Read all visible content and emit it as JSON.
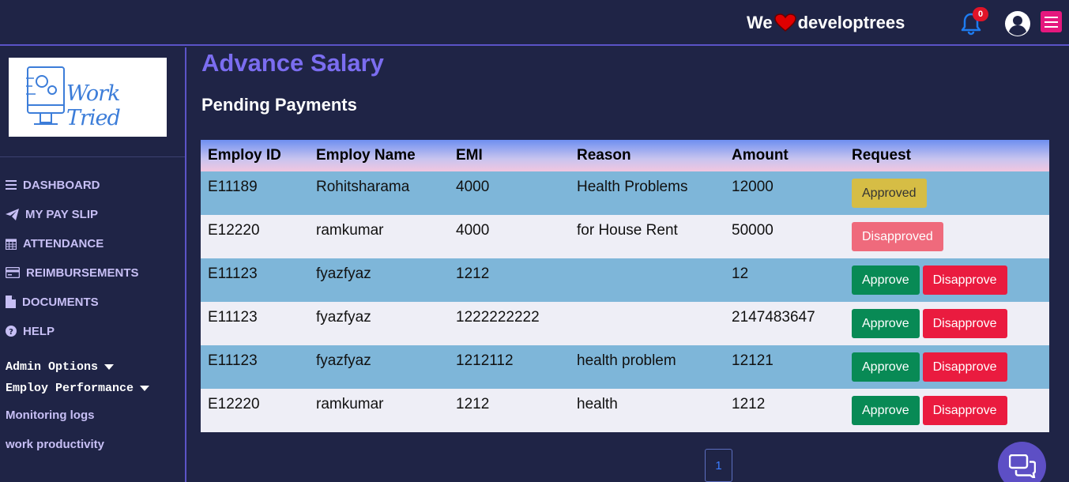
{
  "topbar": {
    "brand_before": "We",
    "brand_after": "developtrees",
    "notification_count": "0",
    "icons": [
      "heart-icon",
      "bell-icon",
      "user-circle-icon",
      "hamburger-menu-icon"
    ]
  },
  "sidebar": {
    "logo_text": "Work Tried",
    "nav": [
      {
        "label": "DASHBOARD",
        "icon": "bars-icon"
      },
      {
        "label": "MY PAY SLIP",
        "icon": "paper-plane-icon"
      },
      {
        "label": "ATTENDANCE",
        "icon": "calendar-icon"
      },
      {
        "label": "REIMBURSEMENTS",
        "icon": "credit-card-icon"
      },
      {
        "label": "DOCUMENTS",
        "icon": "file-icon"
      },
      {
        "label": "HELP",
        "icon": "question-circle-icon"
      }
    ],
    "admin_options": "Admin Options",
    "employ_performance": "Employ Performance",
    "sub_links": [
      "Monitoring logs",
      "work productivity"
    ]
  },
  "main": {
    "title": "Advance Salary",
    "section": "Pending Payments",
    "table": {
      "headers": [
        "Employ ID",
        "Employ Name",
        "EMI",
        "Reason",
        "Amount",
        "Request"
      ],
      "rows": [
        {
          "id": "E11189",
          "name": "Rohitsharama",
          "emi": "4000",
          "reason": "Health Problems",
          "amount": "12000",
          "status": "Approved"
        },
        {
          "id": "E12220",
          "name": "ramkumar",
          "emi": "4000",
          "reason": "for House Rent",
          "amount": "50000",
          "status": "Disapproved"
        },
        {
          "id": "E11123",
          "name": "fyazfyaz",
          "emi": "1212",
          "reason": "",
          "amount": "12",
          "status": "pending"
        },
        {
          "id": "E11123",
          "name": "fyazfyaz",
          "emi": "1222222222",
          "reason": "",
          "amount": "2147483647",
          "status": "pending"
        },
        {
          "id": "E11123",
          "name": "fyazfyaz",
          "emi": "1212112",
          "reason": "health problem",
          "amount": "12121",
          "status": "pending"
        },
        {
          "id": "E12220",
          "name": "ramkumar",
          "emi": "1212",
          "reason": "health",
          "amount": "1212",
          "status": "pending"
        }
      ],
      "approve_label": "Approve",
      "disapprove_label": "Disapprove"
    },
    "pagination": {
      "current_page": "1"
    }
  },
  "colors": {
    "background": "#1f2446",
    "accent": "#7b6df0",
    "approve": "#088a55",
    "disapprove": "#ea1b3f",
    "approved_badge": "#d6bd45",
    "disapproved_badge": "#ef6a7c"
  }
}
